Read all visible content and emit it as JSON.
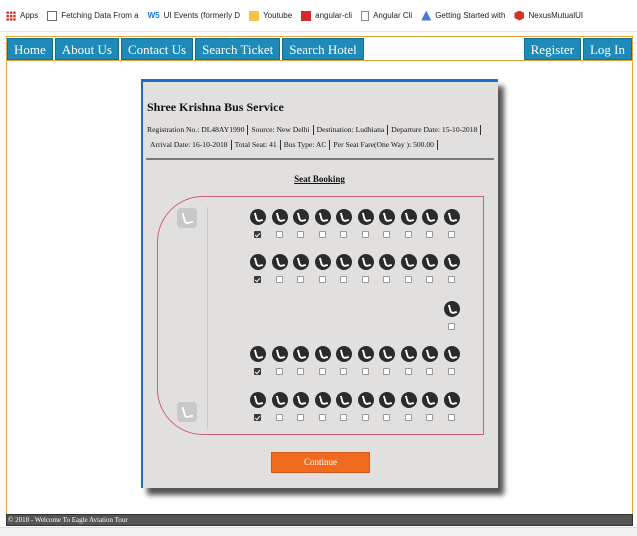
{
  "bookmarks": [
    {
      "label": "Apps",
      "icon": "apps-icon"
    },
    {
      "label": "Fetching Data From a",
      "icon": "doc-icon"
    },
    {
      "label": "UI Events (formerly D",
      "icon": "w3-icon",
      "prefix": "W5"
    },
    {
      "label": "Youtube",
      "icon": "folder-icon"
    },
    {
      "label": "angular-cli",
      "icon": "red-square-icon"
    },
    {
      "label": "Angular Cli",
      "icon": "page-icon"
    },
    {
      "label": "Getting Started with",
      "icon": "angular-icon"
    },
    {
      "label": "NexusMutualUI",
      "icon": "nexus-icon"
    }
  ],
  "nav": {
    "left": [
      "Home",
      "About Us",
      "Contact Us",
      "Search Ticket",
      "Search Hotel"
    ],
    "right": [
      "Register",
      "Log In"
    ],
    "color": "#1e8ab8"
  },
  "bus": {
    "title": "Shree Krishna Bus Service",
    "info_line1": [
      "Registration No.: DL48AY1990",
      "Source: New Delhi",
      "Destination: Ludhiana",
      "Departure Date: 15-10-2018"
    ],
    "info_line2": [
      "Arrival Date: 16-10-2018",
      "Total Seat: 41",
      "Bus Type: AC",
      "Per Seat Fare(One Way ): 500.00"
    ]
  },
  "seat_booking": {
    "title": "Seat Booking",
    "rows": [
      {
        "seats": 10,
        "checked": [
          0
        ]
      },
      {
        "seats": 10,
        "checked": [
          0
        ]
      },
      {
        "seats": 1,
        "checked": [],
        "last_only": true
      },
      {
        "seats": 10,
        "checked": [
          0
        ]
      },
      {
        "seats": 10,
        "checked": [
          0
        ]
      }
    ]
  },
  "continue_label": "Continue",
  "footer": "© 2018 - Welcome To Eagle Aviation Tour"
}
